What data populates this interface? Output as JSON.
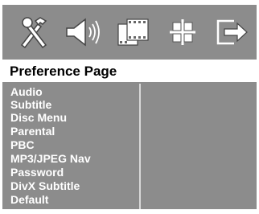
{
  "tabs": [
    {
      "icon": "settings-tools-icon"
    },
    {
      "icon": "speaker-audio-icon"
    },
    {
      "icon": "film-video-icon"
    },
    {
      "icon": "preferences-icon"
    },
    {
      "icon": "exit-icon"
    }
  ],
  "page": {
    "title": "Preference Page"
  },
  "menu": {
    "items": [
      "Audio",
      "Subtitle",
      "Disc Menu",
      "Parental",
      "PBC",
      "MP3/JPEG Nav",
      "Password",
      "DivX Subtitle",
      "Default"
    ]
  },
  "colors": {
    "bar": "#8c8c8c",
    "text": "#ffffff",
    "title": "#000000"
  }
}
